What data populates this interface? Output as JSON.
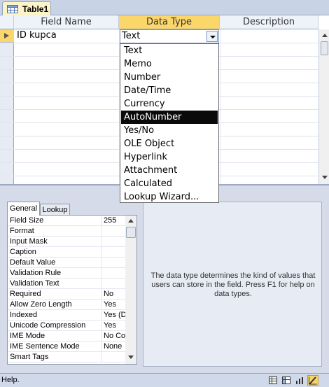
{
  "document_tab": {
    "title": "Table1",
    "icon": "table-icon"
  },
  "grid": {
    "columns": {
      "field_name": "Field Name",
      "data_type": "Data Type",
      "description": "Description"
    },
    "rows": [
      {
        "field_name": "ID kupca",
        "data_type": "Text",
        "description": "",
        "primary_key": true
      }
    ]
  },
  "dropdown": {
    "items": [
      "Text",
      "Memo",
      "Number",
      "Date/Time",
      "Currency",
      "AutoNumber",
      "Yes/No",
      "OLE Object",
      "Hyperlink",
      "Attachment",
      "Calculated",
      "Lookup Wizard..."
    ],
    "selected": "AutoNumber"
  },
  "field_properties": {
    "tabs": [
      "General",
      "Lookup"
    ],
    "active_tab": "General",
    "rows": [
      {
        "name": "Field Size",
        "value": "255"
      },
      {
        "name": "Format",
        "value": ""
      },
      {
        "name": "Input Mask",
        "value": ""
      },
      {
        "name": "Caption",
        "value": ""
      },
      {
        "name": "Default Value",
        "value": ""
      },
      {
        "name": "Validation Rule",
        "value": ""
      },
      {
        "name": "Validation Text",
        "value": ""
      },
      {
        "name": "Required",
        "value": "No"
      },
      {
        "name": "Allow Zero Length",
        "value": "Yes"
      },
      {
        "name": "Indexed",
        "value": "Yes (D"
      },
      {
        "name": "Unicode Compression",
        "value": "Yes"
      },
      {
        "name": "IME Mode",
        "value": "No Co"
      },
      {
        "name": "IME Sentence Mode",
        "value": "None"
      },
      {
        "name": "Smart Tags",
        "value": ""
      }
    ]
  },
  "help_text": "The data type determines the kind of values that users can store in the field. Press F1 for help on data types.",
  "status_bar": {
    "text": "Help.",
    "view_buttons": [
      "datasheet-view-icon",
      "pivottable-view-icon",
      "pivotchart-view-icon",
      "design-view-icon"
    ],
    "active_view": "design-view-icon"
  },
  "colors": {
    "selected_header": "#fbd66a",
    "selected_item_bg": "#0a0a0a",
    "tab_active": "#fdf3c9"
  }
}
